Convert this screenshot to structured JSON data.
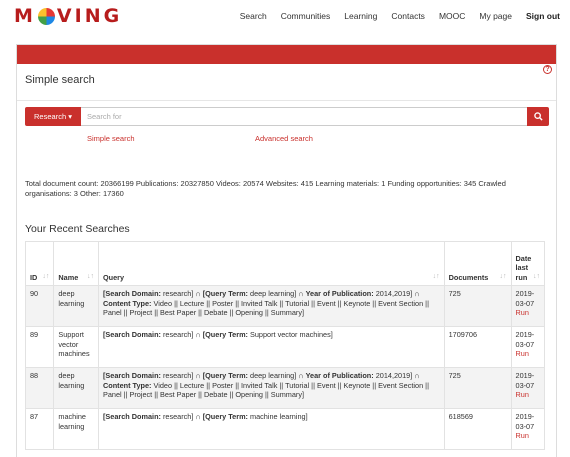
{
  "brand": {
    "logo_text_left": "M",
    "logo_text_right": "VING"
  },
  "nav": {
    "items": [
      "Search",
      "Communities",
      "Learning",
      "Contacts",
      "MOOC",
      "My page"
    ],
    "signout": "Sign out"
  },
  "panel": {
    "title": "Simple search",
    "help": "?"
  },
  "search": {
    "scope_label": "Research ▾",
    "placeholder": "Search for",
    "simple_link": "Simple search",
    "advanced_link": "Advanced search"
  },
  "stats": {
    "text": "Total document count: 20366199 Publications: 20327850 Videos: 20574 Websites: 415 Learning materials: 1 Funding opportunities: 345 Crawled organisations: 3 Other: 17360"
  },
  "recent": {
    "title": "Your Recent Searches",
    "headers": {
      "id": "ID",
      "name": "Name",
      "query": "Query",
      "documents": "Documents",
      "date": "Date last run"
    },
    "rows": [
      {
        "id": "90",
        "name": "deep learning",
        "q1_label": "[Search Domain:",
        "q1_value": " research] ∩ ",
        "q2_label": "[Query Term:",
        "q2_value": " deep learning] ∩ ",
        "q3_label": "Year of Publication:",
        "q3_value": " 2014,2019] ∩ ",
        "q4_label": "Content Type:",
        "q4_value": " Video || Lecture || Poster || Invited Talk || Tutorial || Event || Keynote || Event Section || Panel || Project || Best Paper || Debate || Opening || Summary]",
        "documents": "725",
        "date": "2019-03-07",
        "run": "Run"
      },
      {
        "id": "89",
        "name": "Support vector machines",
        "q1_label": "[Search Domain:",
        "q1_value": " research] ∩ ",
        "q2_label": "[Query Term:",
        "q2_value": " Support vector machines]",
        "q3_label": "",
        "q3_value": "",
        "q4_label": "",
        "q4_value": "",
        "documents": "1709706",
        "date": "2019-03-07",
        "run": "Run"
      },
      {
        "id": "88",
        "name": "deep learning",
        "q1_label": "[Search Domain:",
        "q1_value": " research] ∩ ",
        "q2_label": "[Query Term:",
        "q2_value": " deep learning] ∩ ",
        "q3_label": "Year of Publication:",
        "q3_value": " 2014,2019] ∩ ",
        "q4_label": "Content Type:",
        "q4_value": " Video || Lecture || Poster || Invited Talk || Tutorial || Event || Keynote || Event Section || Panel || Project || Best Paper || Debate || Opening || Summary]",
        "documents": "725",
        "date": "2019-03-07",
        "run": "Run"
      },
      {
        "id": "87",
        "name": "machine learning",
        "q1_label": "[Search Domain:",
        "q1_value": " research] ∩ ",
        "q2_label": "[Query Term:",
        "q2_value": " machine learning]",
        "q3_label": "",
        "q3_value": "",
        "q4_label": "",
        "q4_value": "",
        "documents": "618569",
        "date": "2019-03-07",
        "run": "Run"
      }
    ]
  },
  "colors": {
    "accent": "#c9302c"
  },
  "icons": {
    "search": "magnifier-icon",
    "sort": "sort-icon",
    "help": "help-icon"
  }
}
